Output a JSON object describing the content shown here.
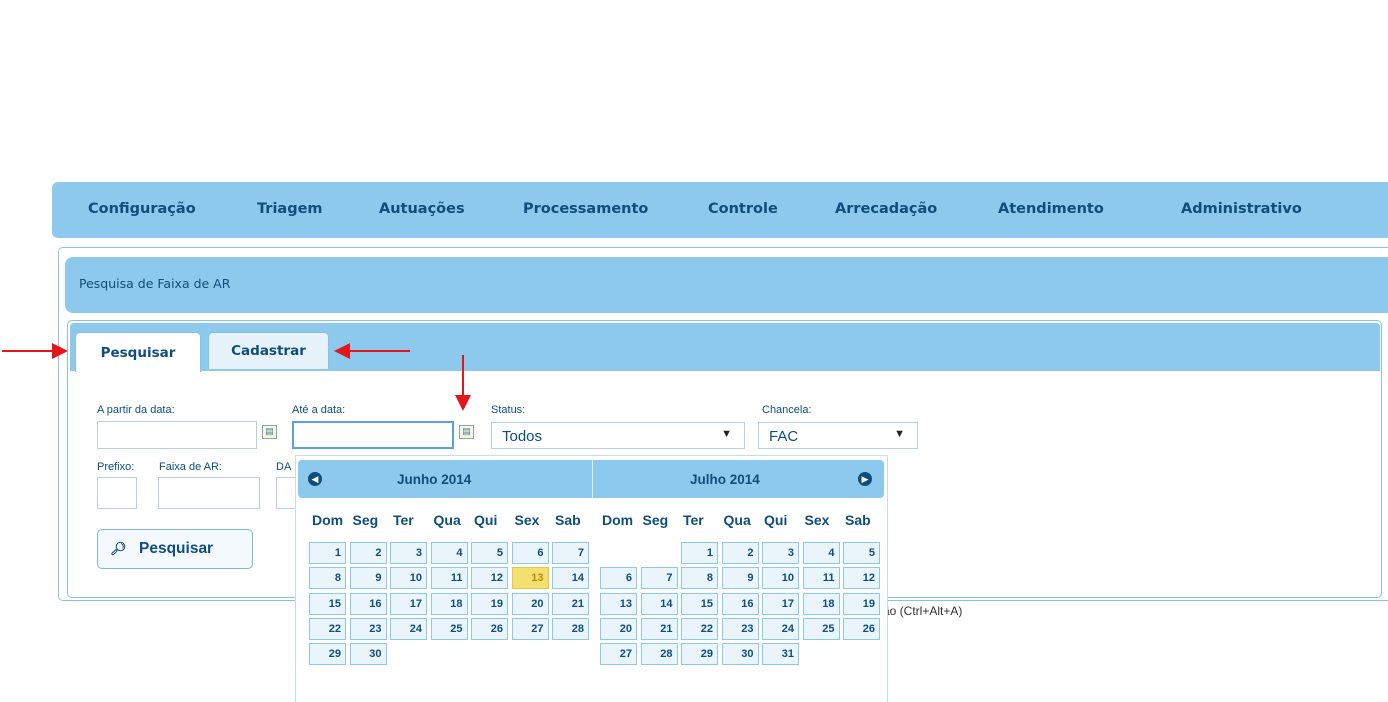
{
  "menu": [
    "Configuração",
    "Triagem",
    "Autuações",
    "Processamento",
    "Controle",
    "Arrecadação",
    "Atendimento",
    "Administrativo"
  ],
  "section_title": "Pesquisa de Faixa de AR",
  "tabs": {
    "active": "Pesquisar",
    "other": "Cadastrar"
  },
  "form": {
    "from_date_label": "A partir da data:",
    "to_date_label": "Até a data:",
    "status_label": "Status:",
    "status_value": "Todos",
    "chancela_label": "Chancela:",
    "chancela_value": "FAC",
    "prefix_label": "Prefixo:",
    "range_label": "Faixa de AR:",
    "da_label": "DA"
  },
  "search_button": "Pesquisar",
  "shortcut_text": "ão (Ctrl+Alt+A)",
  "datepicker": {
    "left_title": "Junho 2014",
    "right_title": "Julho  2014",
    "weekdays": [
      "Dom",
      "Seg",
      "Ter",
      "Qua",
      "Qui",
      "Sex",
      "Sab"
    ],
    "today": 13,
    "june": {
      "first_weekday": 0,
      "days": 30
    },
    "july": {
      "first_weekday": 2,
      "days": 31
    }
  },
  "colors": {
    "bar": "#8cc9ec",
    "text": "#0f4e7c",
    "today": "#f4e06f",
    "arrow": "#e3161b"
  }
}
